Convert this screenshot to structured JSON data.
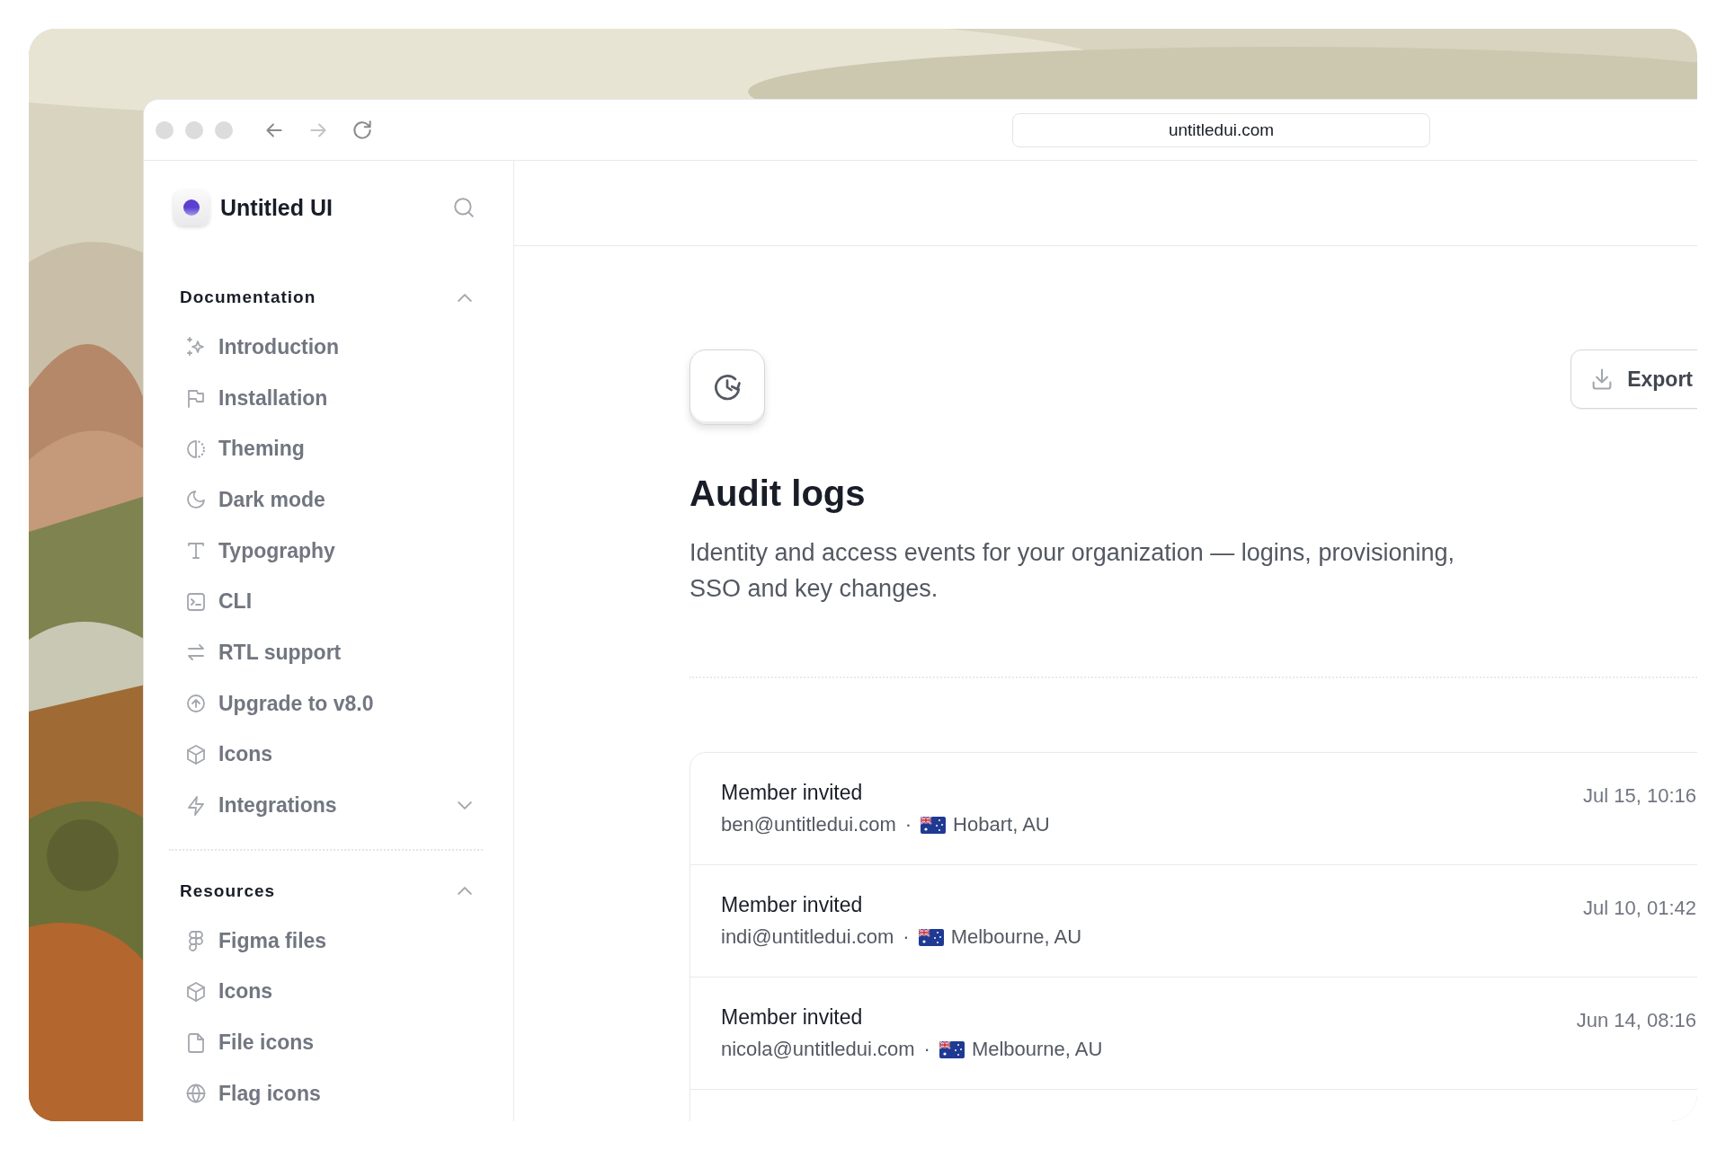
{
  "browser": {
    "url": "untitledui.com"
  },
  "sidebar": {
    "brand": "Untitled UI",
    "sections": [
      {
        "title": "Documentation",
        "expanded": true,
        "items": [
          {
            "label": "Introduction",
            "kind": "link"
          },
          {
            "label": "Installation",
            "kind": "link"
          },
          {
            "label": "Theming",
            "kind": "link"
          },
          {
            "label": "Dark mode",
            "kind": "link"
          },
          {
            "label": "Typography",
            "kind": "link"
          },
          {
            "label": "CLI",
            "kind": "link"
          },
          {
            "label": "RTL support",
            "kind": "link"
          },
          {
            "label": "Upgrade to v8.0",
            "kind": "link"
          },
          {
            "label": "Icons",
            "kind": "link"
          },
          {
            "label": "Integrations",
            "kind": "group",
            "expanded": false
          }
        ]
      },
      {
        "title": "Resources",
        "expanded": true,
        "items": [
          {
            "label": "Figma files",
            "kind": "link"
          },
          {
            "label": "Icons",
            "kind": "link"
          },
          {
            "label": "File icons",
            "kind": "link"
          },
          {
            "label": "Flag icons",
            "kind": "link"
          }
        ]
      }
    ]
  },
  "main": {
    "title": "Audit logs",
    "description": "Identity and access events for your organization — logins, provisioning, SSO and key changes.",
    "export_button": "Export",
    "events": [
      {
        "action": "Member invited",
        "email": "ben@untitledui.com",
        "separator": "·",
        "location": "Hobart, AU",
        "time": "Jul 15, 10:16"
      },
      {
        "action": "Member invited",
        "email": "indi@untitledui.com",
        "separator": "·",
        "location": "Melbourne, AU",
        "time": "Jul 10, 01:42"
      },
      {
        "action": "Member invited",
        "email": "nicola@untitledui.com",
        "separator": "·",
        "location": "Melbourne, AU",
        "time": "Jun 14, 08:16"
      }
    ]
  }
}
